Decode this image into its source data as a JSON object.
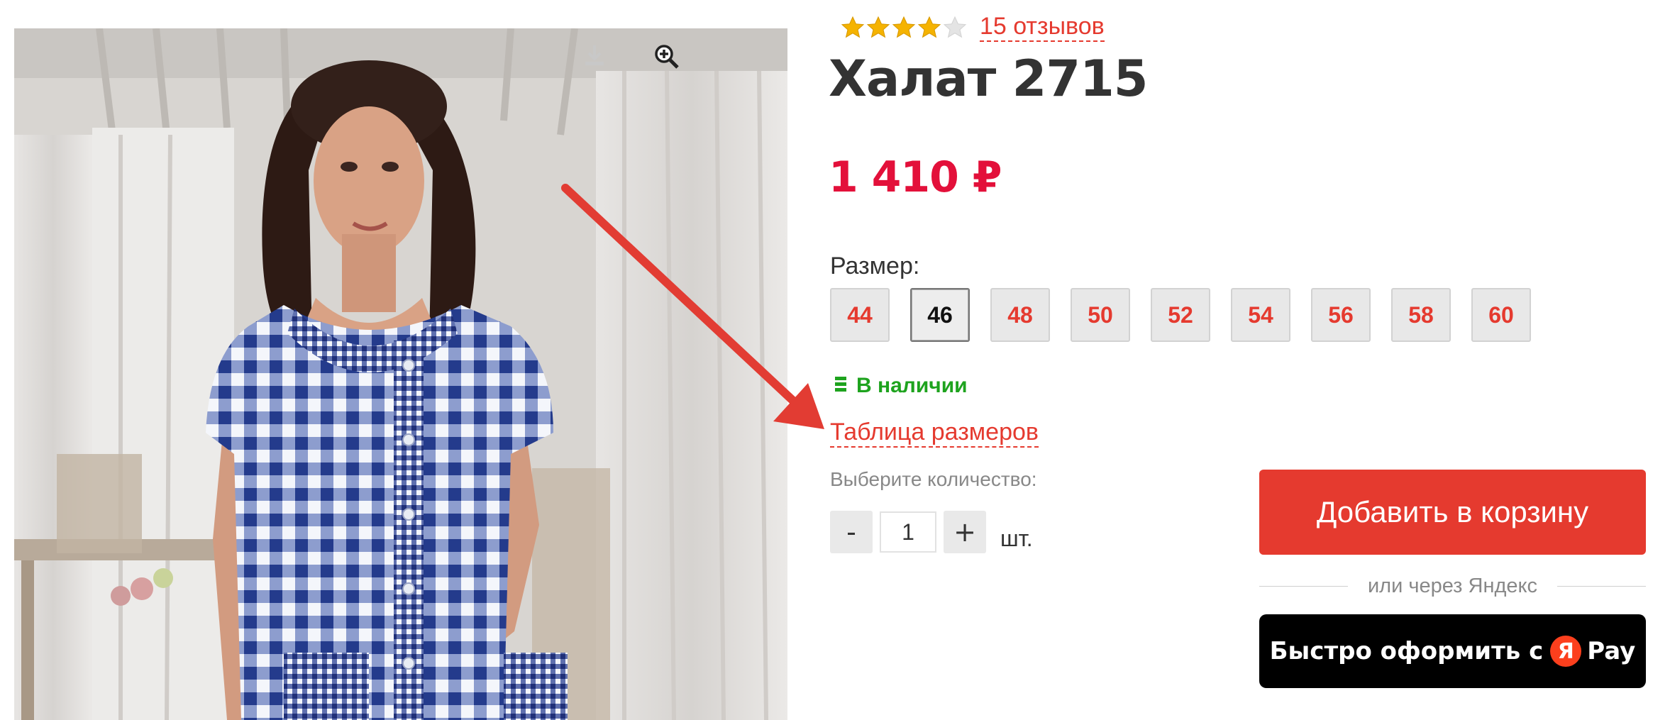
{
  "rating": {
    "stars": 4,
    "max_stars": 5,
    "reviews_link": "15 отзывов"
  },
  "product": {
    "title": "Халат 2715",
    "price": "1 410 ₽"
  },
  "sizes": {
    "label": "Размер:",
    "options": [
      "44",
      "46",
      "48",
      "50",
      "52",
      "54",
      "56",
      "58",
      "60"
    ],
    "selected": "46"
  },
  "stock": {
    "icon": "stock-bars-icon",
    "text": "В наличии"
  },
  "size_table_link": "Таблица размеров",
  "quantity": {
    "label": "Выберите количество:",
    "minus": "-",
    "value": "1",
    "plus": "+",
    "unit": "шт."
  },
  "cart_button": "Добавить в корзину",
  "divider_text": "или через Яндекс",
  "yandex_pay": {
    "label": "Быстро оформить с",
    "logo_letter": "Я",
    "suffix": "Pay"
  },
  "photo": {
    "download_icon": "download-icon",
    "zoom_icon": "zoom-in-icon"
  },
  "colors": {
    "accent": "#e53a2f",
    "price": "#e3103a",
    "in_stock": "#1ea31e",
    "star": "#f5b301"
  }
}
